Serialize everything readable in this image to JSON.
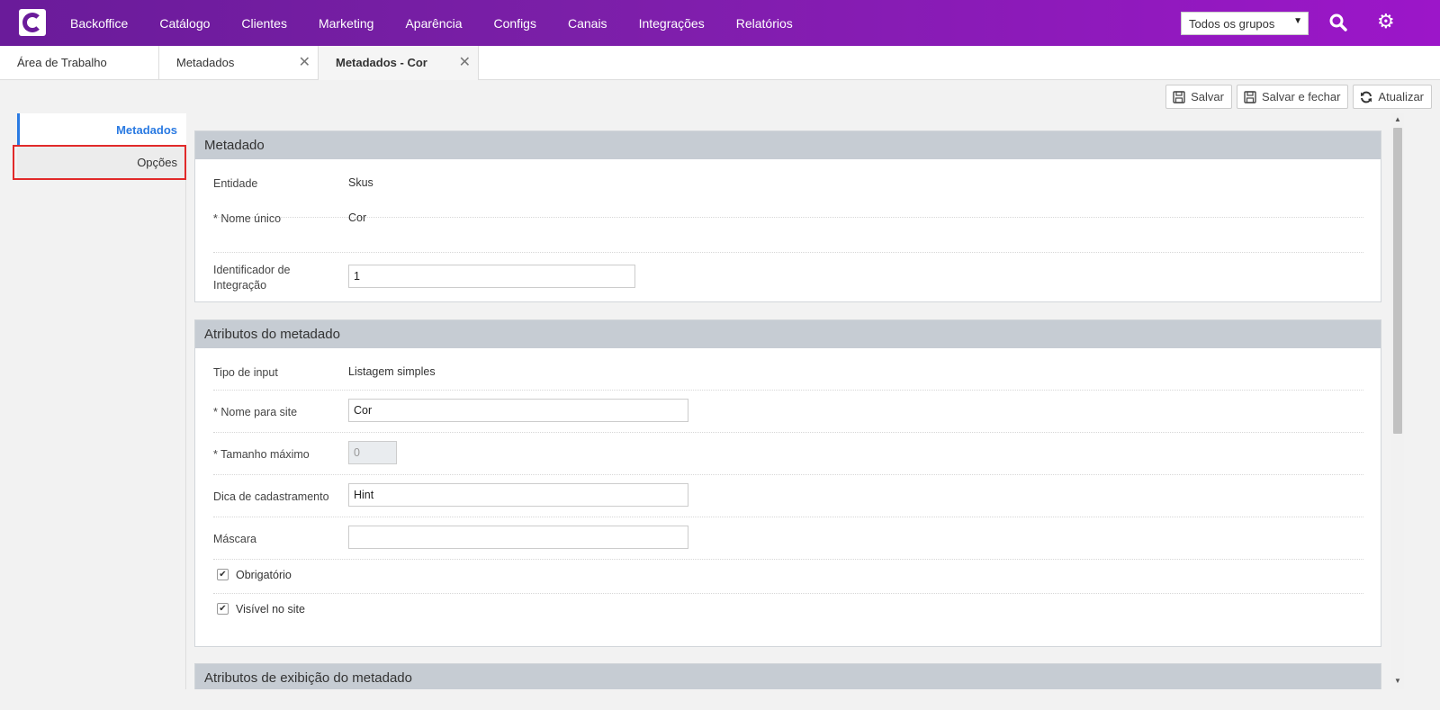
{
  "nav": {
    "items": [
      "Backoffice",
      "Catálogo",
      "Clientes",
      "Marketing",
      "Aparência",
      "Configs",
      "Canais",
      "Integrações",
      "Relatórios"
    ],
    "group_select": "Todos os grupos"
  },
  "tabs": [
    {
      "label": "Área de Trabalho"
    },
    {
      "label": "Metadados"
    },
    {
      "label": "Metadados - Cor"
    }
  ],
  "actions": {
    "save": "Salvar",
    "save_close": "Salvar e fechar",
    "refresh": "Atualizar"
  },
  "sidebar": {
    "items": [
      "Metadados",
      "Opções"
    ]
  },
  "panel_metadado": {
    "title": "Metadado",
    "entidade_label": "Entidade",
    "entidade_value": "Skus",
    "nome_unico_label": "* Nome único",
    "nome_unico_value": "Cor",
    "identificador_label": "Identificador de Integração",
    "identificador_value": "1"
  },
  "panel_atributos": {
    "title": "Atributos do metadado",
    "tipo_input_label": "Tipo de input",
    "tipo_input_value": "Listagem simples",
    "nome_site_label": "* Nome para site",
    "nome_site_value": "Cor",
    "tamanho_label": "* Tamanho máximo",
    "tamanho_value": "0",
    "dica_label": "Dica de cadastramento",
    "dica_value": "Hint",
    "mascara_label": "Máscara",
    "mascara_value": "",
    "obrigatorio_label": "Obrigatório",
    "visivel_label": "Visível no site"
  },
  "panel_exibicao": {
    "title": "Atributos de exibição do metadado"
  }
}
